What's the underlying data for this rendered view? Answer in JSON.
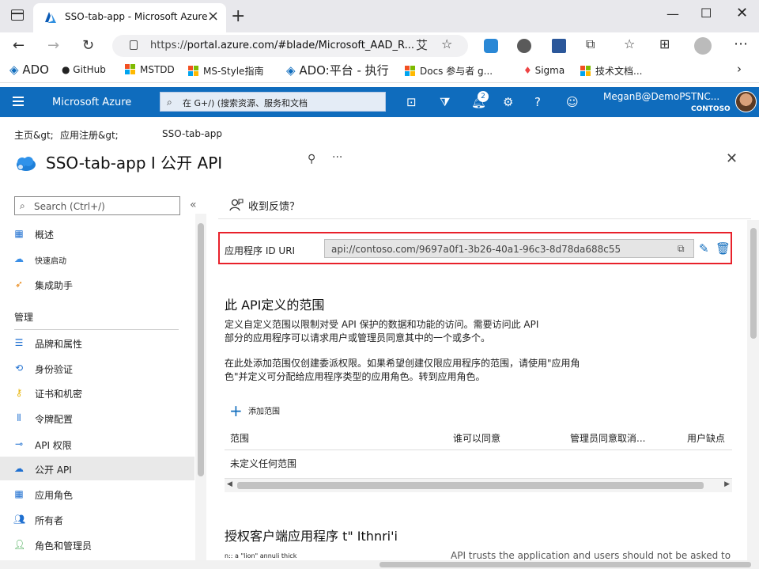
{
  "browser": {
    "tab_title": "SSO-tab-app - Microsoft Azure",
    "url_prefix": "https://",
    "url_main": "portal.azure.com/#blade/Microsoft_AAD_R...",
    "reader_glyph": "艾",
    "bookmarks": [
      "ADO",
      "GitHub",
      "MSTDD",
      "MS-Style指南",
      "ADO:平台 - 执行",
      "Docs 参与者 g...",
      "Sigma",
      "技术文档..."
    ]
  },
  "azure": {
    "brand": "Microsoft Azure",
    "search_placeholder": "在 G+/) (搜索资源、服务和文档",
    "notification_count": "2",
    "user": "MeganB@DemoPSTNC...",
    "org": "CONTOSO"
  },
  "breadcrumb": {
    "home": "主页&gt;",
    "app_reg": "应用注册&gt;",
    "current": "SSO-tab-app"
  },
  "page": {
    "title": "SSO-tab-app I 公开 API"
  },
  "left_nav": {
    "search_placeholder": "Search (Ctrl+/)",
    "items_top": [
      {
        "label": "概述",
        "icon": "overview-icon"
      },
      {
        "label": "快速启动",
        "icon": "quickstart-icon"
      },
      {
        "label": "集成助手",
        "icon": "rocket-icon"
      }
    ],
    "section": "管理",
    "items_manage": [
      {
        "label": "品牌和属性",
        "icon": "branding-icon"
      },
      {
        "label": "身份验证",
        "icon": "authentication-icon"
      },
      {
        "label": "证书和机密",
        "icon": "key-icon"
      },
      {
        "label": "令牌配置",
        "icon": "token-icon"
      },
      {
        "label": "API 权限",
        "icon": "api-permissions-icon"
      },
      {
        "label": "公开 API",
        "icon": "cloud-icon"
      },
      {
        "label": "应用角色",
        "icon": "app-roles-icon"
      },
      {
        "label": "所有者",
        "icon": "owners-icon"
      },
      {
        "label": "角色和管理员",
        "icon": "roles-admins-icon"
      }
    ]
  },
  "main": {
    "feedback": "收到反馈？",
    "uri_label": "应用程序 ID URI",
    "uri_value": "api://contoso.com/9697a0f1-3b26-40a1-96c3-8d78da688c55",
    "scopes_title": "此 API定义的范围",
    "para1": "定义自定义范围以限制对受 API 保护的数据和功能的访问。需要访问此 API 部分的应用程序可以请求用户或管理员同意其中的一个或多个。",
    "para2": "在此处添加范围仅创建委派权限。如果希望创建仅限应用程序的范围，请使用\"应用角色\"并定义可分配给应用程序类型的应用角色。转到应用角色。",
    "add_scope": "添加范围",
    "columns": [
      "范围",
      "谁可以同意",
      "管理员同意取消...",
      "用户缺点"
    ],
    "empty_row": "未定义任何范围",
    "clients_title": "授权客户端应用程序 t\" Ithnri'i",
    "small_note": "n:: a \"lion\" annuli thick",
    "trust_note": "API trusts the application and users should not be asked to"
  },
  "colors": {
    "azure_blue": "#0f6cbd",
    "highlight_red": "#e8212b"
  }
}
